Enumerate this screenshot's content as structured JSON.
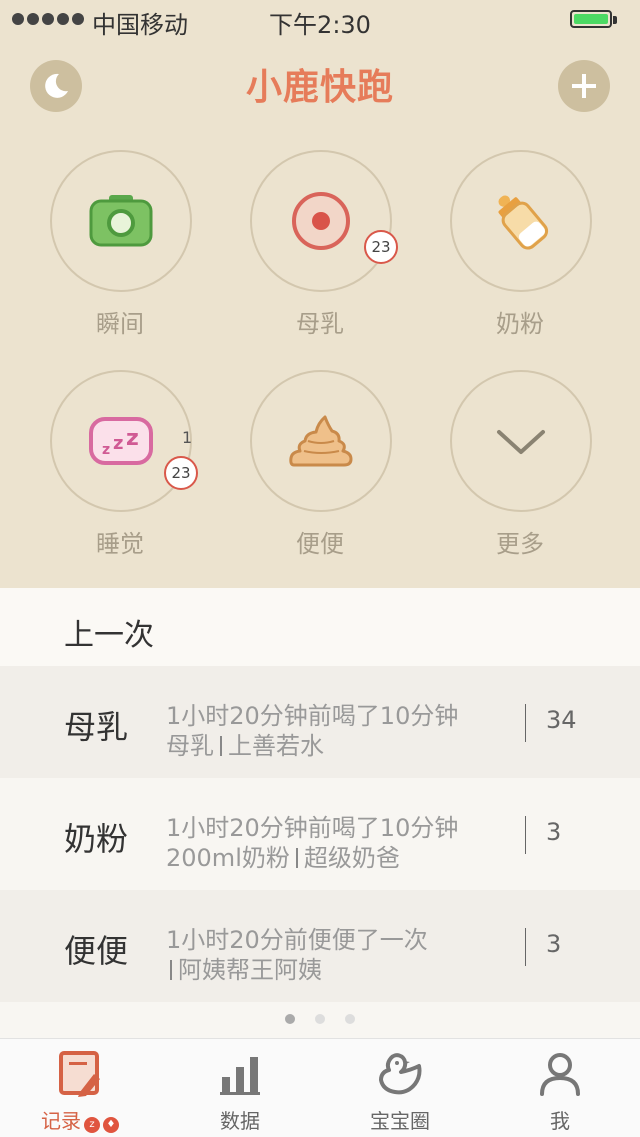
{
  "status_bar": {
    "carrier": "中国移动",
    "time": "下午2:30"
  },
  "header": {
    "title": "小鹿快跑",
    "moon_icon": "moon-icon",
    "add_icon": "plus-icon"
  },
  "actions": [
    {
      "label": "瞬间",
      "icon": "camera-icon"
    },
    {
      "label": "母乳",
      "icon": "breast-icon",
      "badge": "23"
    },
    {
      "label": "奶粉",
      "icon": "bottle-icon"
    },
    {
      "label": "睡觉",
      "icon": "sleep-icon",
      "badge": "23",
      "extra": "1"
    },
    {
      "label": "便便",
      "icon": "poop-icon"
    },
    {
      "label": "更多",
      "icon": "chevron-down-icon"
    }
  ],
  "last": {
    "title": "上一次",
    "records": [
      {
        "type": "母乳",
        "line1": "1小时20分钟前喝了10分钟",
        "line2a": "母乳",
        "line2b": "上善若水",
        "count": "34"
      },
      {
        "type": "奶粉",
        "line1": "1小时20分钟前喝了10分钟",
        "line2a": "200ml奶粉",
        "line2b": "超级奶爸",
        "count": "3"
      },
      {
        "type": "便便",
        "line1": "1小时20分前便便了一次",
        "line2a": "",
        "line2b": "阿姨帮王阿姨",
        "count": "3"
      }
    ]
  },
  "pager": {
    "pages": 3,
    "active": 0
  },
  "tabs": [
    {
      "label": "记录",
      "icon": "record-icon",
      "active": true,
      "mini_badges": [
        "z",
        "♦"
      ]
    },
    {
      "label": "数据",
      "icon": "bar-chart-icon"
    },
    {
      "label": "宝宝圈",
      "icon": "duck-icon"
    },
    {
      "label": "我",
      "icon": "person-icon"
    }
  ],
  "colors": {
    "accent": "#e67c5a",
    "top_bg": "#ece3cf",
    "badge_border": "#d9584a"
  }
}
